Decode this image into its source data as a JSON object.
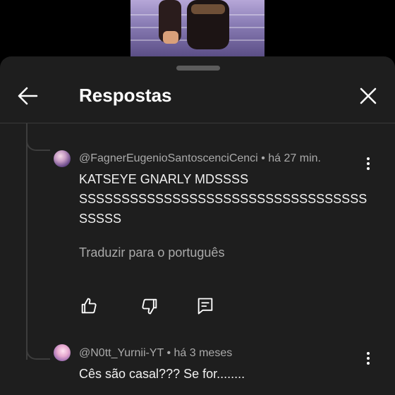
{
  "sheet": {
    "title": "Respostas"
  },
  "replies": [
    {
      "author": "@FagnerEugenioSantoscenciCenci",
      "separator": "•",
      "time": "há 27 min.",
      "text_lines": [
        "KATSEYE GNARLY MDSSSS",
        "SSSSSSSSSSSSSSSSSSSSSSSSSSSSSSSSSS",
        "SSSSS"
      ],
      "translate_label": "Traduzir para o português"
    },
    {
      "author": "@N0tt_Yurnii-YT",
      "separator": "•",
      "time": "há 3 meses",
      "text_lines": [
        "Cês são casal??? Se for........"
      ]
    }
  ],
  "icons": [
    "back-arrow-icon",
    "close-icon",
    "more-vert-icon",
    "thumb-up-icon",
    "thumb-down-icon",
    "reply-comment-icon"
  ]
}
